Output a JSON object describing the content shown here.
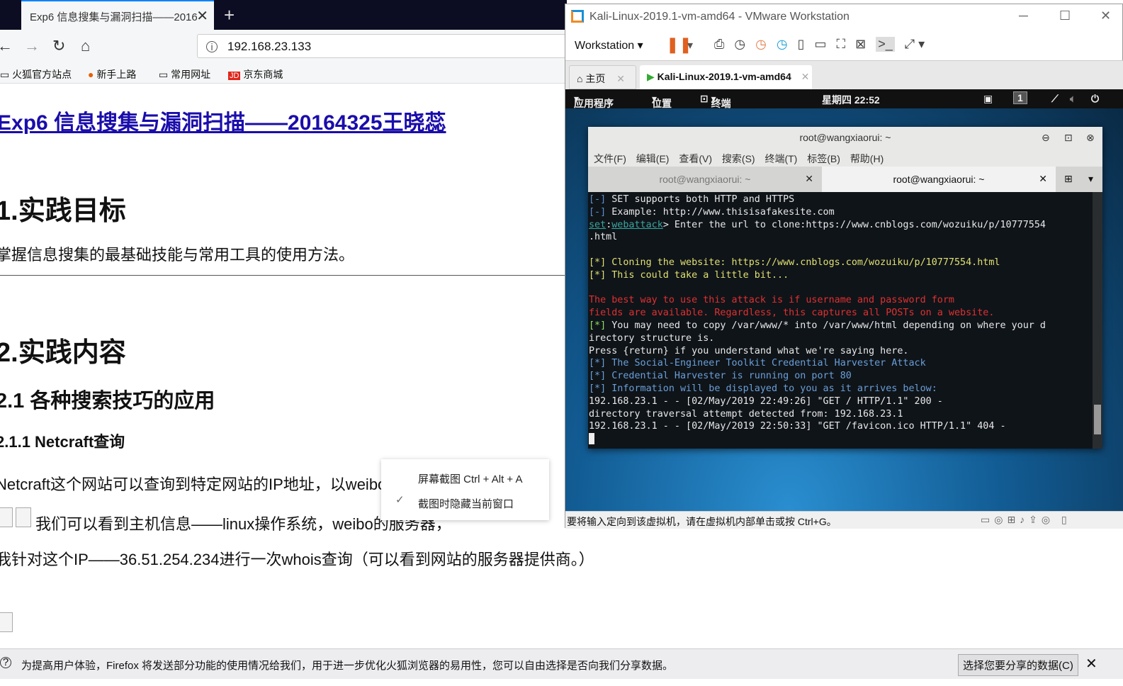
{
  "firefox": {
    "tab_title": "Exp6 信息搜集与漏洞扫描——2016",
    "new_tab": "+",
    "url": "192.168.23.133",
    "bookmarks": [
      "火狐官方站点",
      "新手上路",
      "常用网址",
      "京东商城"
    ],
    "page": {
      "title": "Exp6 信息搜集与漏洞扫描——20164325王晓蕊",
      "h_goal": "1.实践目标",
      "p_goal": "掌握信息搜集的最基础技能与常用工具的使用方法。",
      "h_content": "2.实践内容",
      "h_2_1": "2.1 各种搜索技巧的应用",
      "h_2_1_1": "2.1.1 Netcraft查询",
      "p1": "Netcraft这个网站可以查询到特定网站的IP地址，以weibo.com为例",
      "p2": "我们可以看到主机信息——linux操作系统，weibo的服务器，",
      "p3": "我针对这个IP——36.51.254.234进行一次whois查询（可以看到网站的服务器提供商。）"
    },
    "notification": {
      "text": "为提高用户体验，Firefox 将发送部分功能的使用情况给我们，用于进一步优化火狐浏览器的易用性，您可以自由选择是否向我们分享数据。",
      "button": "选择您要分享的数据(C)"
    }
  },
  "context_menu": {
    "items": [
      "屏幕截图 Ctrl + Alt + A",
      "截图时隐藏当前窗口"
    ],
    "checked_index": 1
  },
  "vmware": {
    "title": "Kali-Linux-2019.1-vm-amd64 - VMware Workstation",
    "menu": "Workstation",
    "tabs": [
      {
        "label": "主页"
      },
      {
        "label": "Kali-Linux-2019.1-vm-amd64",
        "active": true
      }
    ],
    "status": "要将输入定向到该虚拟机，请在虚拟机内部单击或按 Ctrl+G。",
    "kali": {
      "apps": "应用程序",
      "places": "位置",
      "terminal": "终端",
      "clock": "星期四 22:52",
      "workspace": "1",
      "terminal_window": {
        "title": "root@wangxiaorui: ~",
        "menu": [
          "文件(F)",
          "编辑(E)",
          "查看(V)",
          "搜索(S)",
          "终端(T)",
          "标签(B)",
          "帮助(H)"
        ],
        "tabs": [
          "root@wangxiaorui: ~",
          "root@wangxiaorui: ~"
        ],
        "lines": [
          {
            "parts": [
              [
                "[-] ",
                "#5b8fd0"
              ],
              [
                "SET supports both HTTP and HTTPS",
                "#e8e8e8"
              ]
            ]
          },
          {
            "parts": [
              [
                "[-] ",
                "#5b8fd0"
              ],
              [
                "Example: http://www.thisisafakesite.com",
                "#e8e8e8"
              ]
            ]
          },
          {
            "parts": [
              [
                "set",
                "#3aa6a0"
              ],
              [
                ":",
                "#e8e8e8"
              ],
              [
                "webattack",
                "#3aa6a0"
              ],
              [
                "> Enter the url to clone:https://www.cnblogs.com/wozuiku/p/10777554",
                "#e8e8e8"
              ]
            ]
          },
          {
            "parts": [
              [
                ".html",
                "#e8e8e8"
              ]
            ]
          },
          {
            "parts": [
              [
                "",
                "#e8e8e8"
              ]
            ]
          },
          {
            "parts": [
              [
                "[*] Cloning the website: https://www.cnblogs.com/wozuiku/p/10777554.html",
                "#e0e070"
              ]
            ]
          },
          {
            "parts": [
              [
                "[*] This could take a little bit...",
                "#e0e070"
              ]
            ]
          },
          {
            "parts": [
              [
                "",
                "#e8e8e8"
              ]
            ]
          },
          {
            "parts": [
              [
                "The best way to use this attack is if username and password form",
                "#e03030"
              ]
            ]
          },
          {
            "parts": [
              [
                "fields are available. Regardless, this captures all POSTs on a website.",
                "#e03030"
              ]
            ]
          },
          {
            "parts": [
              [
                "[*] ",
                "#8ee060"
              ],
              [
                "You may need to copy /var/www/* into /var/www/html depending on where your d",
                "#e8e8e8"
              ]
            ]
          },
          {
            "parts": [
              [
                "irectory structure is.",
                "#e8e8e8"
              ]
            ]
          },
          {
            "parts": [
              [
                "Press {return} if you understand what we're saying here.",
                "#e8e8e8"
              ]
            ]
          },
          {
            "parts": [
              [
                "[*] The Social-Engineer Toolkit Credential Harvester Attack",
                "#6a9fd8"
              ]
            ]
          },
          {
            "parts": [
              [
                "[*] Credential Harvester is running on port 80",
                "#6a9fd8"
              ]
            ]
          },
          {
            "parts": [
              [
                "[*] Information will be displayed to you as it arrives below:",
                "#6a9fd8"
              ]
            ]
          },
          {
            "parts": [
              [
                "192.168.23.1 - - [02/May/2019 22:49:26] \"GET / HTTP/1.1\" 200 -",
                "#e8e8e8"
              ]
            ]
          },
          {
            "parts": [
              [
                "directory traversal attempt detected from: 192.168.23.1",
                "#e8e8e8"
              ]
            ]
          },
          {
            "parts": [
              [
                "192.168.23.1 - - [02/May/2019 22:50:33] \"GET /favicon.ico HTTP/1.1\" 404 -",
                "#e8e8e8"
              ]
            ]
          }
        ]
      }
    }
  }
}
